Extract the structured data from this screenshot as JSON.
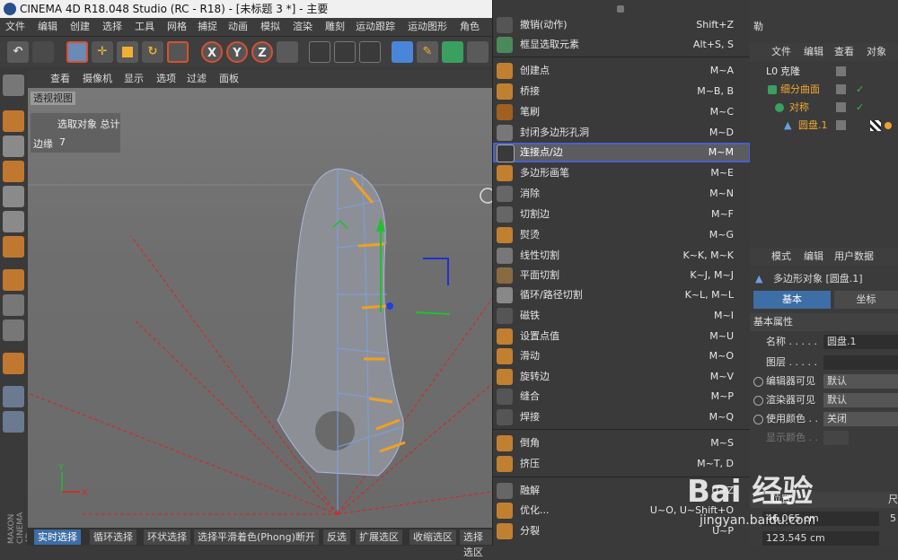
{
  "title_bar": {
    "text": "CINEMA 4D R18.048 Studio (RC - R18) - [未标题 3 *] - 主要"
  },
  "menubar": {
    "items": [
      "文件",
      "编辑",
      "创建",
      "选择",
      "工具",
      "网格",
      "捕捉",
      "动画",
      "模拟",
      "渲染",
      "雕刻",
      "运动跟踪",
      "运动图形",
      "角色"
    ]
  },
  "toolbar": {
    "axes": [
      "X",
      "Y",
      "Z"
    ]
  },
  "viewport": {
    "menu": [
      "查看",
      "摄像机",
      "显示",
      "选项",
      "过滤",
      "面板"
    ],
    "label": "透视视图",
    "stats_header": "选取对象 总计",
    "stats_label": "边缘",
    "stats_value": "7",
    "axis_x": "X",
    "axis_y": "Y",
    "side_label": "MAXON CINEMA 4D"
  },
  "bottom_bar": {
    "items": [
      "实时选择",
      "循环选择",
      "环状选择",
      "选择平滑着色(Phong)断开",
      "反选",
      "扩展选区",
      "收缩选区",
      "选择选区"
    ]
  },
  "popup_menu": {
    "items": [
      {
        "label": "撤销(动作)",
        "shortcut": "Shift+Z"
      },
      {
        "label": "框显选取元素",
        "shortcut": "Alt+S, S"
      },
      {
        "label": "创建点",
        "shortcut": "M~A"
      },
      {
        "label": "桥接",
        "shortcut": "M~B, B"
      },
      {
        "label": "笔刷",
        "shortcut": "M~C"
      },
      {
        "label": "封闭多边形孔洞",
        "shortcut": "M~D"
      },
      {
        "label": "连接点/边",
        "shortcut": "M~M"
      },
      {
        "label": "多边形画笔",
        "shortcut": "M~E"
      },
      {
        "label": "消除",
        "shortcut": "M~N"
      },
      {
        "label": "切割边",
        "shortcut": "M~F"
      },
      {
        "label": "熨烫",
        "shortcut": "M~G"
      },
      {
        "label": "线性切割",
        "shortcut": "K~K, M~K"
      },
      {
        "label": "平面切割",
        "shortcut": "K~J, M~J"
      },
      {
        "label": "循环/路径切割",
        "shortcut": "K~L, M~L"
      },
      {
        "label": "磁铁",
        "shortcut": "M~I"
      },
      {
        "label": "设置点值",
        "shortcut": "M~U"
      },
      {
        "label": "滑动",
        "shortcut": "M~O"
      },
      {
        "label": "旋转边",
        "shortcut": "M~V"
      },
      {
        "label": "缝合",
        "shortcut": "M~P"
      },
      {
        "label": "焊接",
        "shortcut": "M~Q"
      },
      {
        "label": "倒角",
        "shortcut": "M~S"
      },
      {
        "label": "挤压",
        "shortcut": "M~T, D"
      },
      {
        "label": "融解",
        "shortcut": "U~Z"
      },
      {
        "label": "优化...",
        "shortcut": "U~O, U~Shift+O"
      },
      {
        "label": "分裂",
        "shortcut": "U~P"
      }
    ],
    "highlighted": "连接点/边"
  },
  "object_manager": {
    "top_label": "勒",
    "menu": [
      "文件",
      "编辑",
      "查看",
      "对象"
    ],
    "objects": [
      {
        "name": "克隆",
        "color": "#e8e8e8"
      },
      {
        "name": "细分曲面",
        "color": "#f0a830"
      },
      {
        "name": "对称",
        "color": "#f0a830"
      },
      {
        "name": "圆盘.1",
        "color": "#f0a830"
      }
    ]
  },
  "attribute_manager": {
    "menu": [
      "模式",
      "编辑",
      "用户数据"
    ],
    "object_title": "多边形对象 [圆盘.1]",
    "tabs": [
      "基本",
      "坐标"
    ],
    "section": "基本属性",
    "fields": [
      {
        "label": "名称 . . . . .",
        "value": "圆盘.1"
      },
      {
        "label": "图层 . . . . .",
        "value": ""
      },
      {
        "label": "编辑器可见",
        "value": "默认"
      },
      {
        "label": "渲染器可见",
        "value": "默认"
      },
      {
        "label": "使用颜色 . .",
        "value": "关闭"
      },
      {
        "label": "显示颜色 . .",
        "value": ""
      }
    ],
    "section2_label": "位置",
    "section2_right": "尺",
    "coords": [
      "46.065 cm",
      "123.545 cm"
    ],
    "coord_right": "5"
  },
  "watermark": {
    "text": "Bai 经验",
    "url": "jingyan.baidu.com"
  },
  "colors": {
    "highlight_outline": "#4a5fd0",
    "accent_orange": "#f0a830",
    "selection_blue": "#3d6ea5"
  }
}
